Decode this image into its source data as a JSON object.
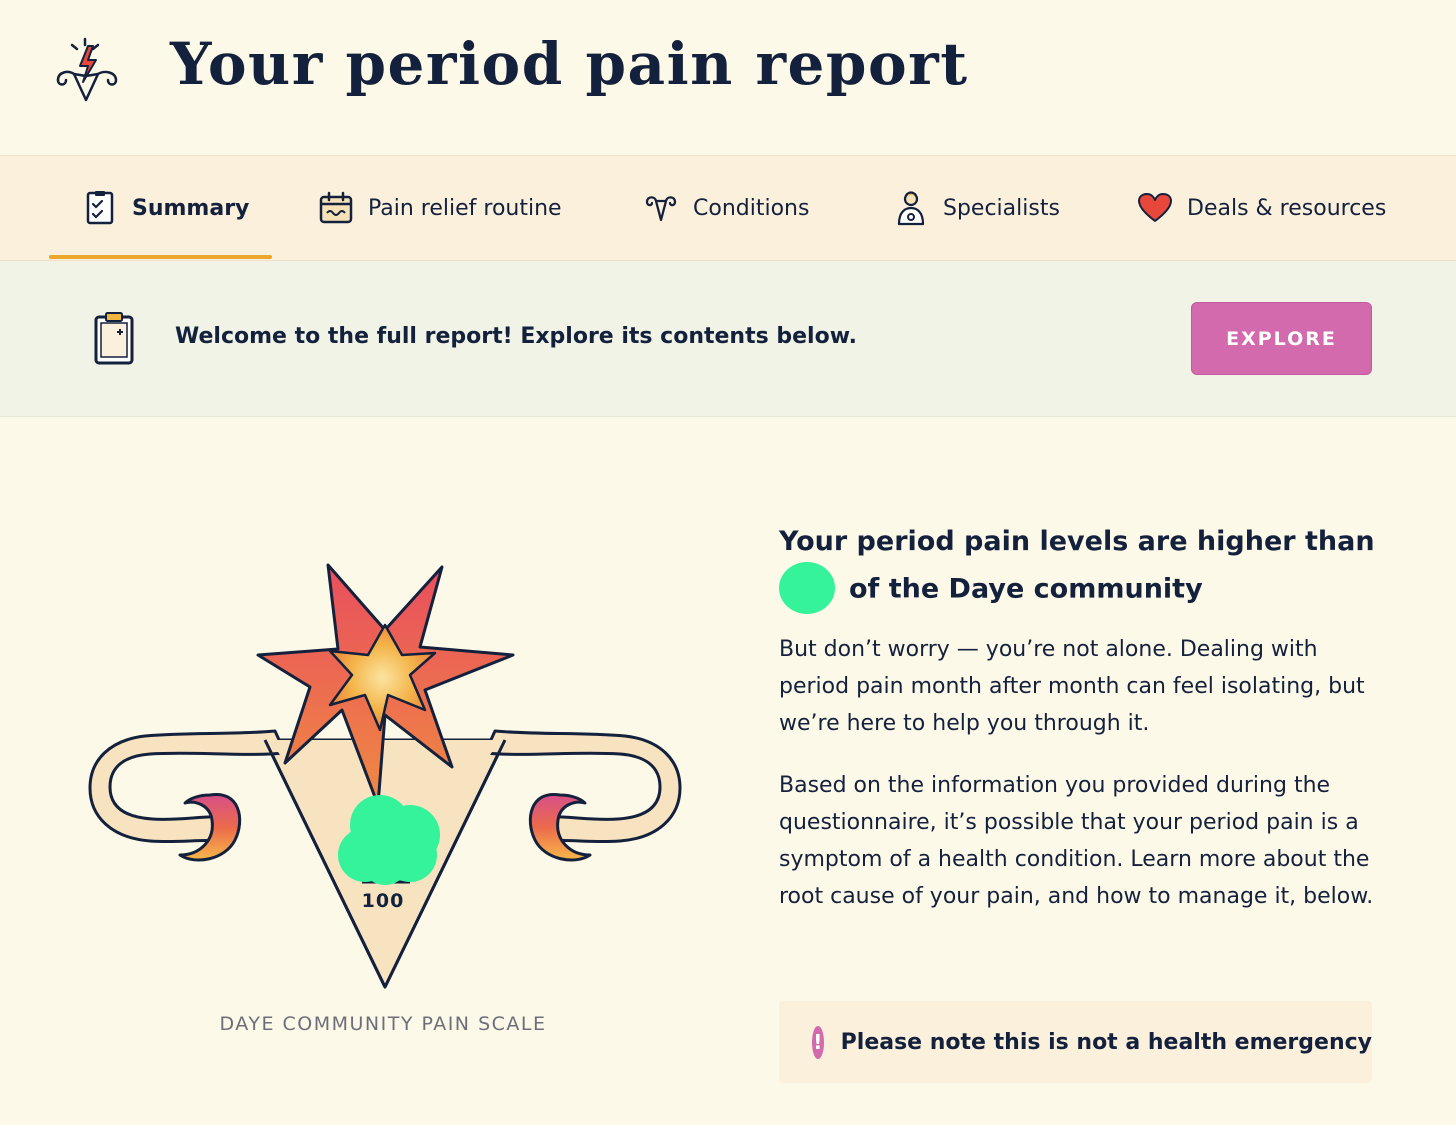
{
  "header": {
    "title": "Your period pain report",
    "logo_icon": "uterus-lightning-icon"
  },
  "tabs": [
    {
      "label": "Summary",
      "icon": "checklist-icon",
      "active": true
    },
    {
      "label": "Pain relief routine",
      "icon": "calendar-icon",
      "active": false
    },
    {
      "label": "Conditions",
      "icon": "uterus-icon",
      "active": false
    },
    {
      "label": "Specialists",
      "icon": "doctor-icon",
      "active": false
    },
    {
      "label": "Deals & resources",
      "icon": "heart-icon",
      "active": false
    }
  ],
  "banner": {
    "text": "Welcome to the full report! Explore its contents below.",
    "icon": "clipboard-icon",
    "button_label": "EXPLORE"
  },
  "illustration": {
    "score": "100",
    "scale_label": "DAYE COMMUNITY PAIN SCALE"
  },
  "content": {
    "headline_line1": "Your period pain levels are higher than",
    "headline_line2": "of the Daye community",
    "paragraph1": "But don’t worry — you’re not alone. Dealing with period pain month after month can feel isolating, but we’re here to help you through it.",
    "paragraph2": "Based on the information you provided during the questionnaire, it’s possible that your period pain is a symptom of a health condition. Learn more about the root cause of your pain, and how to manage it, below."
  },
  "notice": {
    "text": "Please note this is not a health emergency",
    "icon": "exclamation-icon"
  },
  "colors": {
    "background": "#fdf9e8",
    "tab_bar": "#fbf0dc",
    "banner": "#f0f3e5",
    "accent_underline": "#eba62c",
    "button": "#d36aad",
    "text": "#14213d",
    "redaction": "#35f39a"
  }
}
